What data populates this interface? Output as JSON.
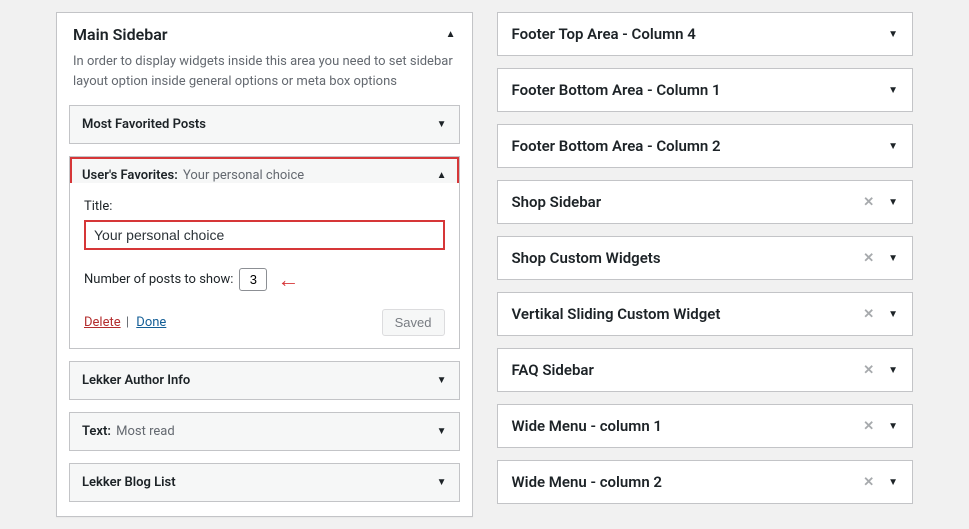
{
  "left_panel": {
    "title": "Main Sidebar",
    "description": "In order to display widgets inside this area you need to set sidebar layout option inside general options or meta box options"
  },
  "widgets": {
    "collapsed_top": {
      "label": "Most Favorited Posts"
    },
    "expanded": {
      "label": "User's Favorites:",
      "sub": "Your personal choice",
      "title_label": "Title:",
      "title_value": "Your personal choice",
      "posts_label": "Number of posts to show:",
      "posts_value": "3",
      "delete": "Delete",
      "done": "Done",
      "saved": "Saved"
    },
    "collapsed_1": {
      "label": "Lekker Author Info"
    },
    "collapsed_2": {
      "label": "Text:",
      "sub": "Most read"
    },
    "collapsed_3": {
      "label": "Lekker Blog List"
    }
  },
  "sidebars": [
    {
      "label": "Footer Top Area - Column 4",
      "clearable": false
    },
    {
      "label": "Footer Bottom Area - Column 1",
      "clearable": false
    },
    {
      "label": "Footer Bottom Area - Column 2",
      "clearable": false
    },
    {
      "label": "Shop Sidebar",
      "clearable": true
    },
    {
      "label": "Shop Custom Widgets",
      "clearable": true
    },
    {
      "label": "Vertikal Sliding Custom Widget",
      "clearable": true
    },
    {
      "label": "FAQ Sidebar",
      "clearable": true
    },
    {
      "label": "Wide Menu - column 1",
      "clearable": true
    },
    {
      "label": "Wide Menu - column 2",
      "clearable": true
    }
  ]
}
